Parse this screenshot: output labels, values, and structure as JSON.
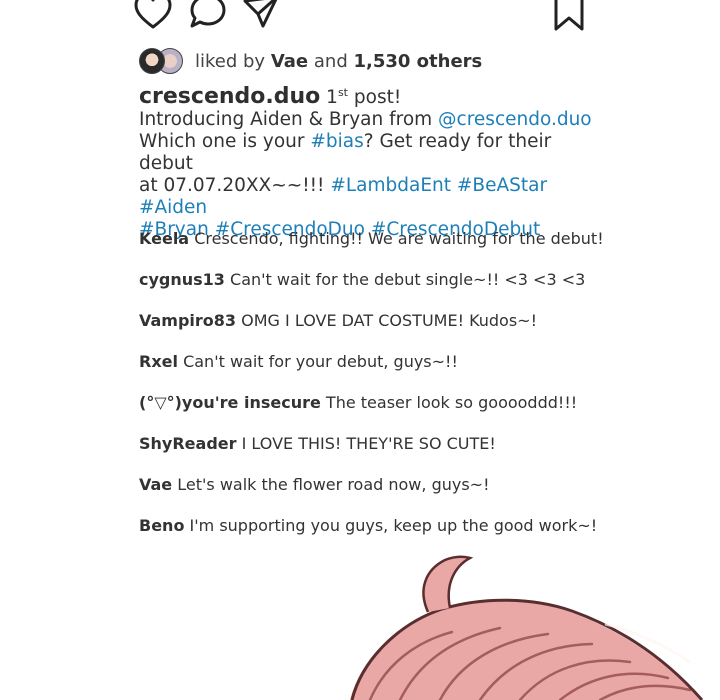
{
  "post": {
    "likes": {
      "prefix": "liked by",
      "user": "Vae",
      "and": "and",
      "count": "1,530 others"
    },
    "caption": {
      "username": "crescendo.duo",
      "first_part": "1",
      "first_sup": "st",
      "post_word": "post!",
      "line2_text": "Introducing Aiden & Bryan from",
      "mention": "@crescendo.duo",
      "line3_text": "Which one is your",
      "bias_tag": "#bias",
      "line3_rest": "? Get ready for their debut",
      "line4_text": "at 07.07.20XX~~!!!",
      "hashtags_line4": [
        "#LambdaEnt",
        "#BeAStar",
        "#Aiden"
      ],
      "hashtags_line5": [
        "#Bryan",
        "#CrescendoDuo",
        "#CrescendoDebut"
      ]
    },
    "comments": [
      {
        "user": "Keela",
        "text": "Crescendo, fighting!! We are waiting for the debut!"
      },
      {
        "user": "cygnus13",
        "text": "Can't wait for the debut single~!! <3 <3 <3"
      },
      {
        "user": "Vampiro83",
        "text": "OMG I LOVE DAT COSTUME! Kudos~!"
      },
      {
        "user": "Rxel",
        "text": "Can't wait for your debut, guys~!!"
      },
      {
        "user": "(°▽°)you're insecure",
        "text": "The teaser look so gooooddd!!!"
      },
      {
        "user": "ShyReader",
        "text": "I LOVE THIS! THEY'RE SO CUTE!"
      },
      {
        "user": "Vae",
        "text": "Let's walk the flower road now, guys~!"
      },
      {
        "user": "Beno",
        "text": "I'm supporting you guys, keep up the good work~!"
      }
    ]
  },
  "icons": {
    "like": "heart-icon",
    "comment": "comment-bubble-icon",
    "share": "paper-plane-icon",
    "save": "bookmark-icon"
  },
  "colors": {
    "hashtag": "#1d7fb8",
    "text": "#333333",
    "hair": "#e9a7a6"
  }
}
